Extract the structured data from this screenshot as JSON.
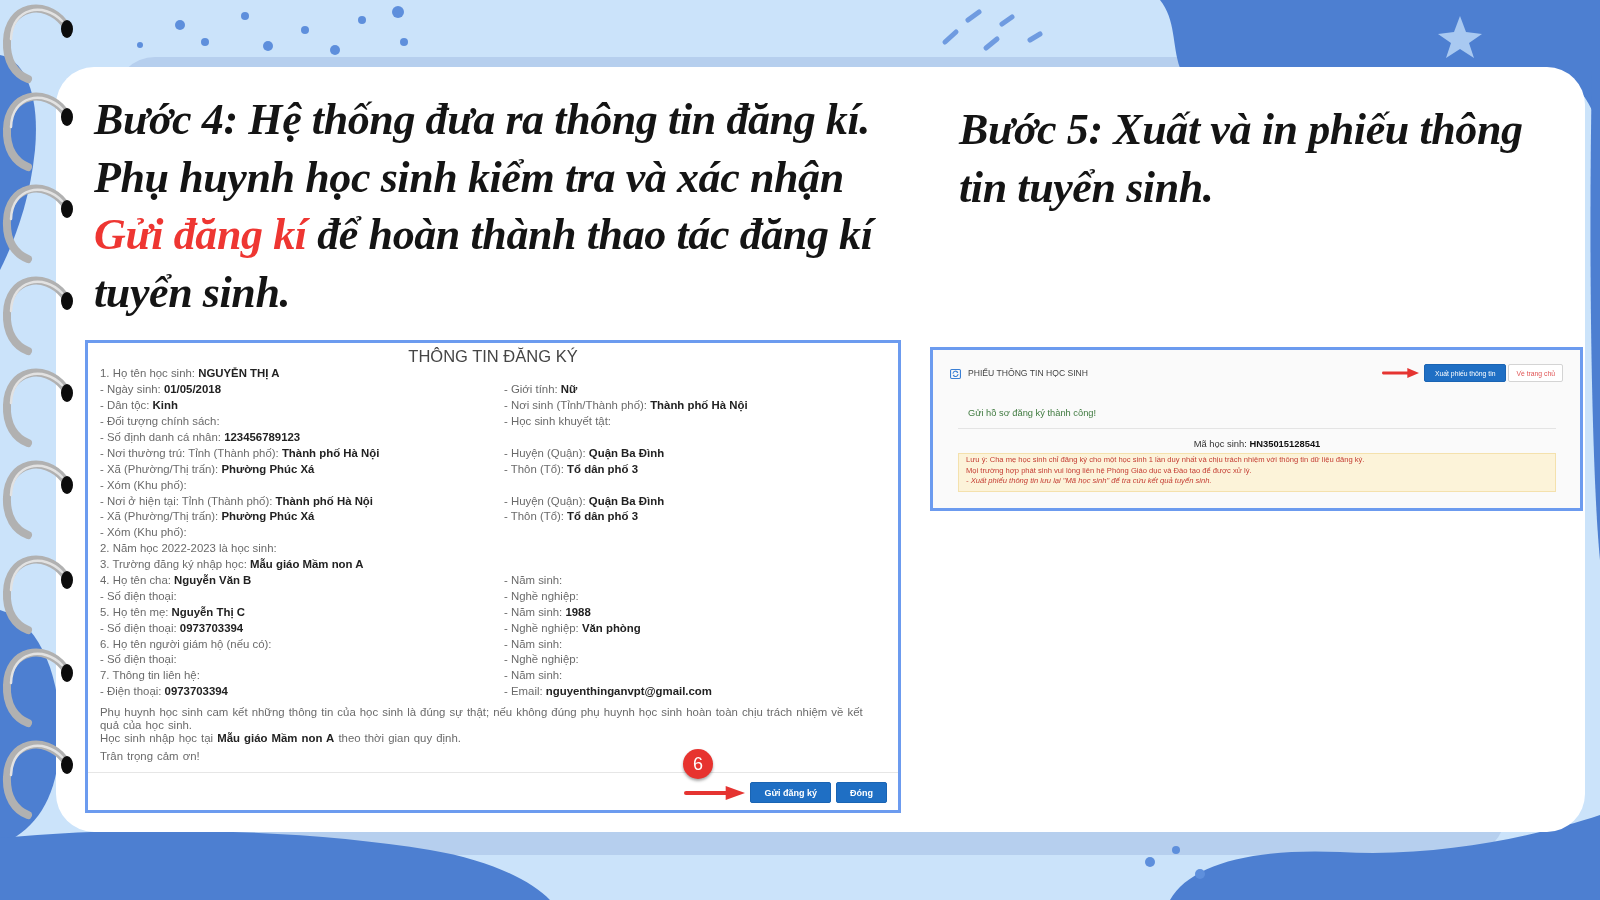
{
  "step_4": {
    "heading": [
      {
        "text": "Bước 4: Hệ thống đưa ra thông tin đăng kí. Phụ huynh học sinh kiểm tra và xác nhận ",
        "highlight": false
      },
      {
        "text": "Gửi đăng kí",
        "highlight": true
      },
      {
        "text": " để hoàn thành thao tác đăng kí tuyển sinh.",
        "highlight": false
      }
    ],
    "form": {
      "title": "THÔNG TIN ĐĂNG KÝ",
      "rows": [
        {
          "left": "1. Họ tên học sinh: **NGUYỄN THỊ A**"
        },
        {
          "left": "- Ngày sinh: **01/05/2018**",
          "right": "- Giới tính: **Nữ**"
        },
        {
          "left": "- Dân tộc: **Kinh**",
          "right": "- Nơi sinh (Tỉnh/Thành phố): **Thành phố Hà Nội**"
        },
        {
          "left": "- Đối tượng chính sách:",
          "right": "- Học sinh khuyết tật:"
        },
        {
          "left": "- Số định danh cá nhân: **123456789123**"
        },
        {
          "left": "- Nơi thường trú: Tỉnh (Thành phố): **Thành phố Hà Nội**",
          "right": "- Huyện (Quận): **Quận Ba Đình**"
        },
        {
          "left": "- Xã (Phường/Thị trấn): **Phường Phúc Xá**",
          "right": "- Thôn (Tổ): **Tổ dân phố 3**"
        },
        {
          "left": "- Xóm (Khu phố):"
        },
        {
          "left": "- Nơi ở hiện tại: Tỉnh (Thành phố): **Thành phố Hà Nội**",
          "right": "- Huyện (Quận): **Quận Ba Đình**"
        },
        {
          "left": "- Xã (Phường/Thị trấn): **Phường Phúc Xá**",
          "right": "- Thôn (Tổ): **Tổ dân phố 3**"
        },
        {
          "left": "- Xóm (Khu phố):"
        },
        {
          "left": "2. Năm học 2022-2023 là học sinh:"
        },
        {
          "left": "3. Trường đăng ký nhập học: **Mẫu giáo Mầm non A**"
        },
        {
          "left": "4. Họ tên cha: **Nguyễn Văn B**",
          "right": "- Năm sinh:"
        },
        {
          "left": "- Số điện thoại:",
          "right": "- Nghề nghiệp:"
        },
        {
          "left": "5. Họ tên mẹ: **Nguyễn Thị C**",
          "right": "- Năm sinh: **1988**"
        },
        {
          "left": "- Số điện thoại: **0973703394**",
          "right": "- Nghề nghiệp: **Văn phòng**"
        },
        {
          "left": "6. Họ tên người giám hộ (nếu có):",
          "right": "- Năm sinh:"
        },
        {
          "left": "- Số điện thoại:",
          "right": "- Nghề nghiệp:"
        },
        {
          "left": "7. Thông tin liên hệ:",
          "right": "- Năm sinh:"
        },
        {
          "left": "- Điện thoại: **0973703394**",
          "right": "- Email: **nguyenthinganvpt@gmail.com**"
        }
      ],
      "notes": [
        "Phụ huynh học sinh cam kết những thông tin của học sinh là đúng sự thật; nếu không đúng phụ huynh học sinh hoàn toàn chịu trách nhiệm về kết quả của học sinh.",
        "Học sinh nhập học tại **Mẫu giáo Mầm non A** theo thời gian quy định."
      ],
      "closing": "Trân trọng cảm ơn!",
      "badge": "6",
      "buttons": [
        {
          "label": "Gửi đăng ký",
          "kind": "primary",
          "marked": true
        },
        {
          "label": "Đóng",
          "kind": "primary",
          "marked": false
        }
      ]
    }
  },
  "step_5": {
    "heading": [
      {
        "text": "Bước 5: Xuất và in phiếu thông tin tuyển sinh.",
        "highlight": false
      }
    ],
    "result": {
      "title": "PHIẾU THÔNG TIN HỌC SINH",
      "buttons": [
        {
          "label": "Xuất phiếu thông tin",
          "kind": "primary",
          "marked": true
        },
        {
          "label": "Về trang chủ",
          "kind": "outline",
          "marked": false
        }
      ],
      "message": "Gửi hồ sơ đăng ký thành công!",
      "student_code": "Mã học sinh: **HN35015128541**",
      "notice": [
        {
          "text": "Lưu ý: Cha mẹ học sinh chỉ đăng ký cho một học sinh 1 lần duy nhất và chịu trách nhiệm với thông tin dữ liệu đăng ký.",
          "kind": "note"
        },
        {
          "text": "Mọi trường hợp phát sinh vui lòng liên hệ Phòng Giáo dục và Đào tạo để được xử lý.",
          "kind": "note"
        },
        {
          "text": "- Xuất phiếu thông tin lưu lại \"Mã học sinh\" để tra cứu kết quả tuyển sinh.",
          "kind": "tip"
        }
      ]
    }
  }
}
